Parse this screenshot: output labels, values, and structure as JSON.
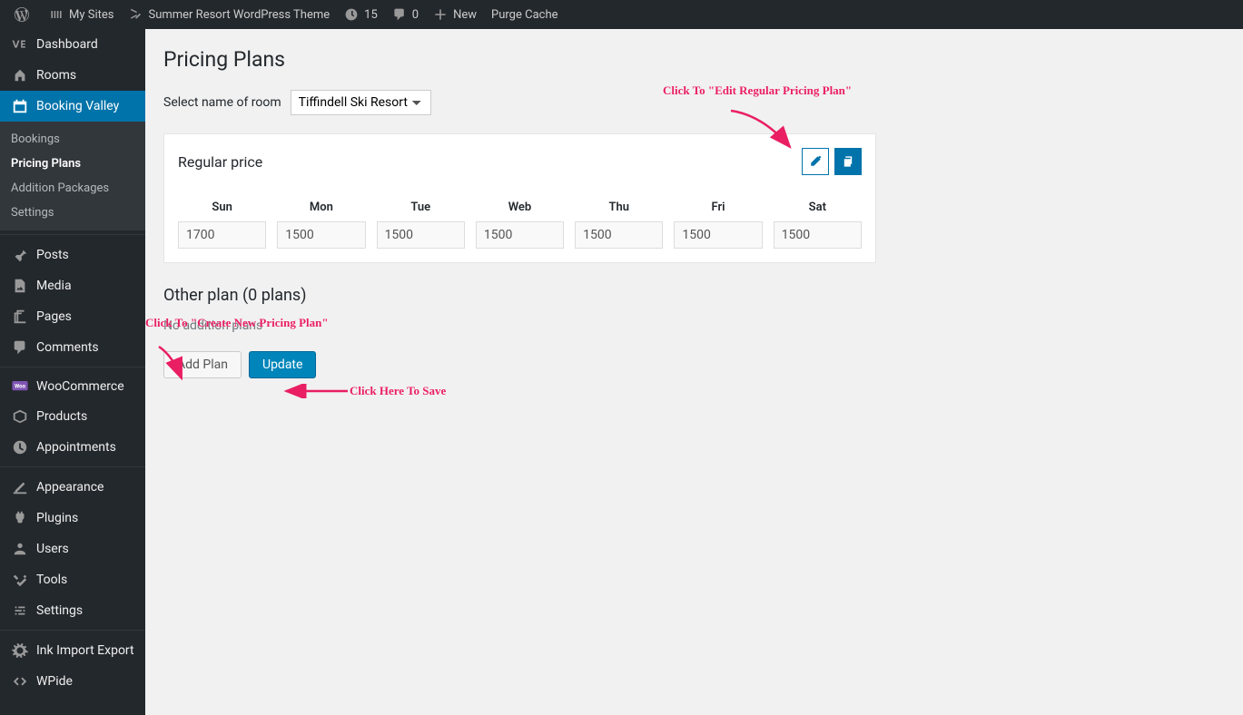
{
  "adminbar": {
    "mysites": "My Sites",
    "sitename": "Summer Resort WordPress Theme",
    "updates_count": "15",
    "comments_count": "0",
    "new_label": "New",
    "purge_label": "Purge Cache"
  },
  "menu": {
    "dashboard": "Dashboard",
    "rooms": "Rooms",
    "booking_valley": "Booking Valley",
    "posts": "Posts",
    "media": "Media",
    "pages": "Pages",
    "comments": "Comments",
    "woocommerce": "WooCommerce",
    "products": "Products",
    "appointments": "Appointments",
    "appearance": "Appearance",
    "plugins": "Plugins",
    "users": "Users",
    "tools": "Tools",
    "settings": "Settings",
    "ink": "Ink Import Export",
    "wpide": "WPide"
  },
  "submenu": {
    "bookings": "Bookings",
    "pricing_plans": "Pricing Plans",
    "addition_packages": "Addition Packages",
    "settings": "Settings"
  },
  "page": {
    "title": "Pricing Plans",
    "select_room_label": "Select name of room",
    "room_options": [
      "Tiffindell Ski Resort"
    ],
    "room_selected": "Tiffindell Ski Resort"
  },
  "regular_price": {
    "title": "Regular price",
    "days": [
      "Sun",
      "Mon",
      "Tue",
      "Web",
      "Thu",
      "Fri",
      "Sat"
    ],
    "values": [
      "1700",
      "1500",
      "1500",
      "1500",
      "1500",
      "1500",
      "1500"
    ]
  },
  "other_plan": {
    "title": "Other plan (0 plans)",
    "empty_text": "No addition plans",
    "add_plan_label": "Add Plan",
    "update_label": "Update"
  },
  "annotations": {
    "edit_regular": "Click To \"Edit Regular Pricing Plan\"",
    "create_new": "Click To \"Create New Pricing Plan\"",
    "save": "Click Here To Save"
  }
}
